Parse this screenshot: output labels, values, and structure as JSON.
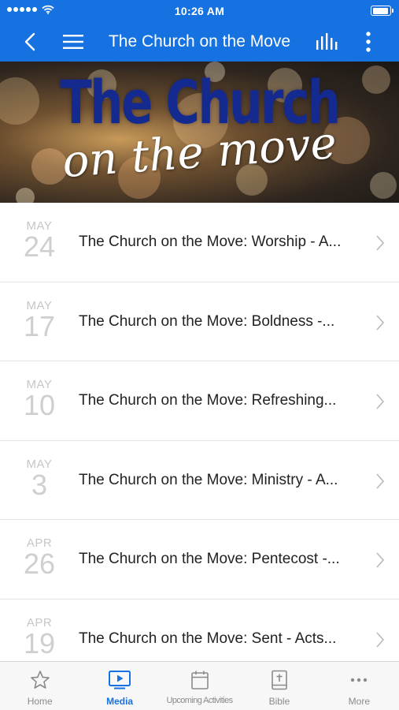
{
  "status_bar": {
    "time": "10:26 AM",
    "signal_icon": "signal-dots-icon",
    "wifi_icon": "wifi-icon",
    "battery_icon": "battery-icon",
    "battery_level": 0.95
  },
  "nav_bar": {
    "title": "The Church on the Move",
    "back_icon": "chevron-left-icon",
    "menu_icon": "hamburger-menu-icon",
    "audio_icon": "audio-bars-icon",
    "more_icon": "vertical-dots-icon"
  },
  "banner": {
    "title": "The Church",
    "subtitle": "on the move"
  },
  "colors": {
    "primary": "#1672e0",
    "banner_title": "#142a8e",
    "date_gray": "#c6c6c6",
    "tab_inactive": "#8a8a8a"
  },
  "media_list": [
    {
      "month": "MAY",
      "day": "24",
      "title": "The Church on the Move: Worship - A..."
    },
    {
      "month": "MAY",
      "day": "17",
      "title": "The Church on the Move: Boldness -..."
    },
    {
      "month": "MAY",
      "day": "10",
      "title": "The Church on the Move: Refreshing..."
    },
    {
      "month": "MAY",
      "day": "3",
      "title": "The Church on the Move: Ministry - A..."
    },
    {
      "month": "APR",
      "day": "26",
      "title": "The Church on the Move: Pentecost -..."
    },
    {
      "month": "APR",
      "day": "19",
      "title": "The Church on the Move: Sent - Acts..."
    }
  ],
  "tab_bar": {
    "tabs": [
      {
        "label": "Home",
        "icon": "star-icon",
        "active": false
      },
      {
        "label": "Media",
        "icon": "tv-play-icon",
        "active": true
      },
      {
        "label": "Upcoming Activities",
        "icon": "calendar-icon",
        "active": false
      },
      {
        "label": "Bible",
        "icon": "bible-icon",
        "active": false
      },
      {
        "label": "More",
        "icon": "more-dots-icon",
        "active": false
      }
    ]
  }
}
